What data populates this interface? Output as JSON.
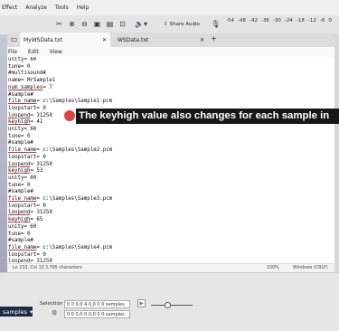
{
  "menubar": {
    "items": [
      "Effect",
      "Analyze",
      "Tools",
      "Help"
    ]
  },
  "toolbar": {
    "share_label": "Share Audio",
    "meter_ticks": [
      "-54",
      "-48",
      "-42",
      "-36",
      "-30",
      "-24",
      "-18",
      "-12",
      "-6",
      "0"
    ]
  },
  "notepad": {
    "tabs": [
      {
        "label": "MyWSData.txt",
        "active": true
      },
      {
        "label": "WSData.txt",
        "active": false
      }
    ],
    "new_tab": "+",
    "menu": [
      "File",
      "Edit",
      "View"
    ],
    "lines": [
      "unity= 60",
      "tune= 0",
      "#multisound#",
      "name= MrSample1",
      "num_samples= 7",
      "#sample#",
      "file_name= c:\\Samples\\Sample1.pcm",
      "loopstart= 0",
      "loopend= 31250",
      "keyhigh= 41",
      "unity= 60",
      "tune= 0",
      "#sample#",
      "file_name= c:\\Samples\\Sample2.pcm",
      "loopstart= 0",
      "loopend= 31250",
      "keyhigh= 53",
      "unity= 60",
      "tune= 0",
      "#sample#",
      "file_name= c:\\Samples\\Sample3.pcm",
      "loopstart= 0",
      "loopend= 31250",
      "keyhigh= 65",
      "unity= 60",
      "tune= 0",
      "#sample#",
      "file_name= c:\\Samples\\Sample4.pcm",
      "loopstart= 0",
      "loopend= 31250",
      "keyhigh= 77"
    ],
    "status": {
      "position": "Ln 233, Col 13",
      "chars": "3,795 characters",
      "zoom": "100%",
      "eol": "Windows (CRLF)"
    }
  },
  "callout": {
    "text": "The keyhigh value also changes for each sample in"
  },
  "bottom": {
    "samples_label": "samples",
    "selection_label": "Selection",
    "time1": "0 0 0,0 4 0,0 0 0 samples",
    "time2": "0 0 0,0 0 0,0 0 0 samples"
  },
  "colors": {
    "callout_bg": "#181818",
    "record": "#e0443e",
    "navy": "#1f2a44"
  }
}
